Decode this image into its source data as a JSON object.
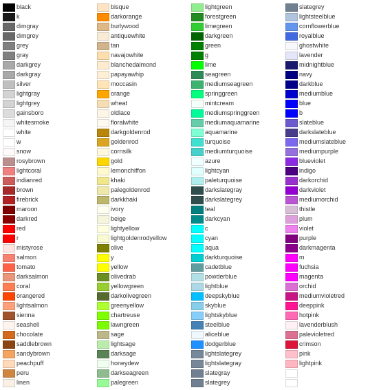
{
  "columns": [
    {
      "id": "col1",
      "items": [
        {
          "name": "black",
          "color": "#000000"
        },
        {
          "name": "k",
          "color": "#1a1a1a"
        },
        {
          "name": "dimgray",
          "color": "#696969"
        },
        {
          "name": "dimgrey",
          "color": "#696969"
        },
        {
          "name": "grey",
          "color": "#808080"
        },
        {
          "name": "gray",
          "color": "#808080"
        },
        {
          "name": "darkgrey",
          "color": "#a9a9a9"
        },
        {
          "name": "darkgray",
          "color": "#a9a9a9"
        },
        {
          "name": "silver",
          "color": "#c0c0c0"
        },
        {
          "name": "lightgray",
          "color": "#d3d3d3"
        },
        {
          "name": "lightgrey",
          "color": "#d3d3d3"
        },
        {
          "name": "gainsboro",
          "color": "#dcdcdc"
        },
        {
          "name": "whitesmoke",
          "color": "#f5f5f5"
        },
        {
          "name": "white",
          "color": "#ffffff"
        },
        {
          "name": "w",
          "color": "#ffffff"
        },
        {
          "name": "snow",
          "color": "#fffafa"
        },
        {
          "name": "rosybrown",
          "color": "#bc8f8f"
        },
        {
          "name": "lightcoral",
          "color": "#f08080"
        },
        {
          "name": "indianred",
          "color": "#cd5c5c"
        },
        {
          "name": "brown",
          "color": "#a52a2a"
        },
        {
          "name": "firebrick",
          "color": "#b22222"
        },
        {
          "name": "maroon",
          "color": "#800000"
        },
        {
          "name": "darkred",
          "color": "#8b0000"
        },
        {
          "name": "red",
          "color": "#ff0000"
        },
        {
          "name": "r",
          "color": "#ff0000"
        },
        {
          "name": "mistyrose",
          "color": "#ffe4e1"
        },
        {
          "name": "salmon",
          "color": "#fa8072"
        },
        {
          "name": "tomato",
          "color": "#ff6347"
        },
        {
          "name": "darksalmon",
          "color": "#e9967a"
        },
        {
          "name": "coral",
          "color": "#ff7f50"
        },
        {
          "name": "orangered",
          "color": "#ff4500"
        },
        {
          "name": "lightsalmon",
          "color": "#ffa07a"
        },
        {
          "name": "sienna",
          "color": "#a0522d"
        },
        {
          "name": "seashell",
          "color": "#fff5ee"
        },
        {
          "name": "chocolate",
          "color": "#d2691e"
        },
        {
          "name": "saddlebrown",
          "color": "#8b4513"
        },
        {
          "name": "sandybrown",
          "color": "#f4a460"
        },
        {
          "name": "peachpuff",
          "color": "#ffdab9"
        },
        {
          "name": "peru",
          "color": "#cd853f"
        },
        {
          "name": "linen",
          "color": "#faf0e6"
        }
      ]
    },
    {
      "id": "col2",
      "items": [
        {
          "name": "bisque",
          "color": "#ffe4c4"
        },
        {
          "name": "darkorange",
          "color": "#ff8c00"
        },
        {
          "name": "burlywood",
          "color": "#deb887"
        },
        {
          "name": "antiquewhite",
          "color": "#faebd7"
        },
        {
          "name": "tan",
          "color": "#d2b48c"
        },
        {
          "name": "navajowhite",
          "color": "#ffdead"
        },
        {
          "name": "blanchedalmond",
          "color": "#ffebcd"
        },
        {
          "name": "papayawhip",
          "color": "#ffefd5"
        },
        {
          "name": "moccasin",
          "color": "#ffe4b5"
        },
        {
          "name": "orange",
          "color": "#ffa500"
        },
        {
          "name": "wheat",
          "color": "#f5deb3"
        },
        {
          "name": "oldlace",
          "color": "#fdf5e6"
        },
        {
          "name": "floralwhite",
          "color": "#fffaf0"
        },
        {
          "name": "darkgoldenrod",
          "color": "#b8860b"
        },
        {
          "name": "goldenrod",
          "color": "#daa520"
        },
        {
          "name": "cornsilk",
          "color": "#fff8dc"
        },
        {
          "name": "gold",
          "color": "#ffd700"
        },
        {
          "name": "lemonchiffon",
          "color": "#fffacd"
        },
        {
          "name": "khaki",
          "color": "#f0e68c"
        },
        {
          "name": "palegoldenrod",
          "color": "#eee8aa"
        },
        {
          "name": "darkkhaki",
          "color": "#bdb76b"
        },
        {
          "name": "ivory",
          "color": "#fffff0"
        },
        {
          "name": "beige",
          "color": "#f5f5dc"
        },
        {
          "name": "lightyellow",
          "color": "#ffffe0"
        },
        {
          "name": "lightgoldenrodyellow",
          "color": "#fafad2"
        },
        {
          "name": "olive",
          "color": "#808000"
        },
        {
          "name": "y",
          "color": "#ffff00"
        },
        {
          "name": "yellow",
          "color": "#ffff00"
        },
        {
          "name": "olivedrab",
          "color": "#6b8e23"
        },
        {
          "name": "yellowgreen",
          "color": "#9acd32"
        },
        {
          "name": "darkolivegreen",
          "color": "#556b2f"
        },
        {
          "name": "greenyellow",
          "color": "#adff2f"
        },
        {
          "name": "chartreuse",
          "color": "#7fff00"
        },
        {
          "name": "lawngreen",
          "color": "#7cfc00"
        },
        {
          "name": "sage",
          "color": "#bcb88a"
        },
        {
          "name": "lightsage",
          "color": "#bcecac"
        },
        {
          "name": "darksage",
          "color": "#598556"
        },
        {
          "name": "honeydew",
          "color": "#f0fff0"
        },
        {
          "name": "darkseagreen",
          "color": "#8fbc8f"
        },
        {
          "name": "palegreen",
          "color": "#98fb98"
        }
      ]
    },
    {
      "id": "col3",
      "items": [
        {
          "name": "lightgreen",
          "color": "#90ee90"
        },
        {
          "name": "forestgreen",
          "color": "#228b22"
        },
        {
          "name": "limegreen",
          "color": "#32cd32"
        },
        {
          "name": "darkgreen",
          "color": "#006400"
        },
        {
          "name": "green",
          "color": "#008000"
        },
        {
          "name": "g",
          "color": "#008000"
        },
        {
          "name": "lime",
          "color": "#00ff00"
        },
        {
          "name": "seagreen",
          "color": "#2e8b57"
        },
        {
          "name": "mediumseagreen",
          "color": "#3cb371"
        },
        {
          "name": "springgreen",
          "color": "#00ff7f"
        },
        {
          "name": "mintcream",
          "color": "#f5fffa"
        },
        {
          "name": "mediumspringgreen",
          "color": "#00fa9a"
        },
        {
          "name": "mediumaquamarine",
          "color": "#66cdaa"
        },
        {
          "name": "aquamarine",
          "color": "#7fffd4"
        },
        {
          "name": "turquoise",
          "color": "#40e0d0"
        },
        {
          "name": "mediumturquoise",
          "color": "#48d1cc"
        },
        {
          "name": "azure",
          "color": "#f0ffff"
        },
        {
          "name": "lightcyan",
          "color": "#e0ffff"
        },
        {
          "name": "paleturquoise",
          "color": "#afeeee"
        },
        {
          "name": "darkslategray",
          "color": "#2f4f4f"
        },
        {
          "name": "darkslategrey",
          "color": "#2f4f4f"
        },
        {
          "name": "teal",
          "color": "#008080"
        },
        {
          "name": "darkcyan",
          "color": "#008b8b"
        },
        {
          "name": "c",
          "color": "#00ffff"
        },
        {
          "name": "cyan",
          "color": "#00ffff"
        },
        {
          "name": "aqua",
          "color": "#00ffff"
        },
        {
          "name": "darkturquoise",
          "color": "#00ced1"
        },
        {
          "name": "cadetblue",
          "color": "#5f9ea0"
        },
        {
          "name": "powderblue",
          "color": "#b0e0e6"
        },
        {
          "name": "lightblue",
          "color": "#add8e6"
        },
        {
          "name": "deepskyblue",
          "color": "#00bfff"
        },
        {
          "name": "skyblue",
          "color": "#87ceeb"
        },
        {
          "name": "lightskyblue",
          "color": "#87cefa"
        },
        {
          "name": "steelblue",
          "color": "#4682b4"
        },
        {
          "name": "aliceblue",
          "color": "#f0f8ff"
        },
        {
          "name": "dodgerblue",
          "color": "#1e90ff"
        },
        {
          "name": "lightslategrey",
          "color": "#778899"
        },
        {
          "name": "lightslategray",
          "color": "#778899"
        },
        {
          "name": "slategray",
          "color": "#708090"
        },
        {
          "name": "slategrey",
          "color": "#708090"
        }
      ]
    },
    {
      "id": "col4",
      "items": [
        {
          "name": "slategrey",
          "color": "#708090"
        },
        {
          "name": "lightsteelblue",
          "color": "#b0c4de"
        },
        {
          "name": "cornflowerblue",
          "color": "#6495ed"
        },
        {
          "name": "royalblue",
          "color": "#4169e1"
        },
        {
          "name": "ghostwhite",
          "color": "#f8f8ff"
        },
        {
          "name": "lavender",
          "color": "#e6e6fa"
        },
        {
          "name": "midnightblue",
          "color": "#191970"
        },
        {
          "name": "navy",
          "color": "#000080"
        },
        {
          "name": "darkblue",
          "color": "#00008b"
        },
        {
          "name": "mediumblue",
          "color": "#0000cd"
        },
        {
          "name": "blue",
          "color": "#0000ff"
        },
        {
          "name": "b",
          "color": "#0000ff"
        },
        {
          "name": "slateblue",
          "color": "#6a5acd"
        },
        {
          "name": "darkslateblue",
          "color": "#483d8b"
        },
        {
          "name": "mediumslateblue",
          "color": "#7b68ee"
        },
        {
          "name": "mediumpurple",
          "color": "#9370db"
        },
        {
          "name": "blueviolet",
          "color": "#8a2be2"
        },
        {
          "name": "indigo",
          "color": "#4b0082"
        },
        {
          "name": "darkorchid",
          "color": "#9932cc"
        },
        {
          "name": "darkviolet",
          "color": "#9400d3"
        },
        {
          "name": "mediumorchid",
          "color": "#ba55d3"
        },
        {
          "name": "thistle",
          "color": "#d8bfd8"
        },
        {
          "name": "plum",
          "color": "#dda0dd"
        },
        {
          "name": "violet",
          "color": "#ee82ee"
        },
        {
          "name": "purple",
          "color": "#800080"
        },
        {
          "name": "darkmagenta",
          "color": "#8b008b"
        },
        {
          "name": "m",
          "color": "#ff00ff"
        },
        {
          "name": "fuchsia",
          "color": "#ff00ff"
        },
        {
          "name": "magenta",
          "color": "#ff00ff"
        },
        {
          "name": "orchid",
          "color": "#da70d6"
        },
        {
          "name": "mediumvioletred",
          "color": "#c71585"
        },
        {
          "name": "deeppink",
          "color": "#ff1493"
        },
        {
          "name": "hotpink",
          "color": "#ff69b4"
        },
        {
          "name": "lavenderblush",
          "color": "#fff0f5"
        },
        {
          "name": "palevioletred",
          "color": "#db7093"
        },
        {
          "name": "crimson",
          "color": "#dc143c"
        },
        {
          "name": "pink",
          "color": "#ffc0cb"
        },
        {
          "name": "lightpink",
          "color": "#ffb6c1"
        },
        {
          "name": "",
          "color": "#ffffff"
        },
        {
          "name": "",
          "color": "#ffffff"
        }
      ]
    }
  ]
}
